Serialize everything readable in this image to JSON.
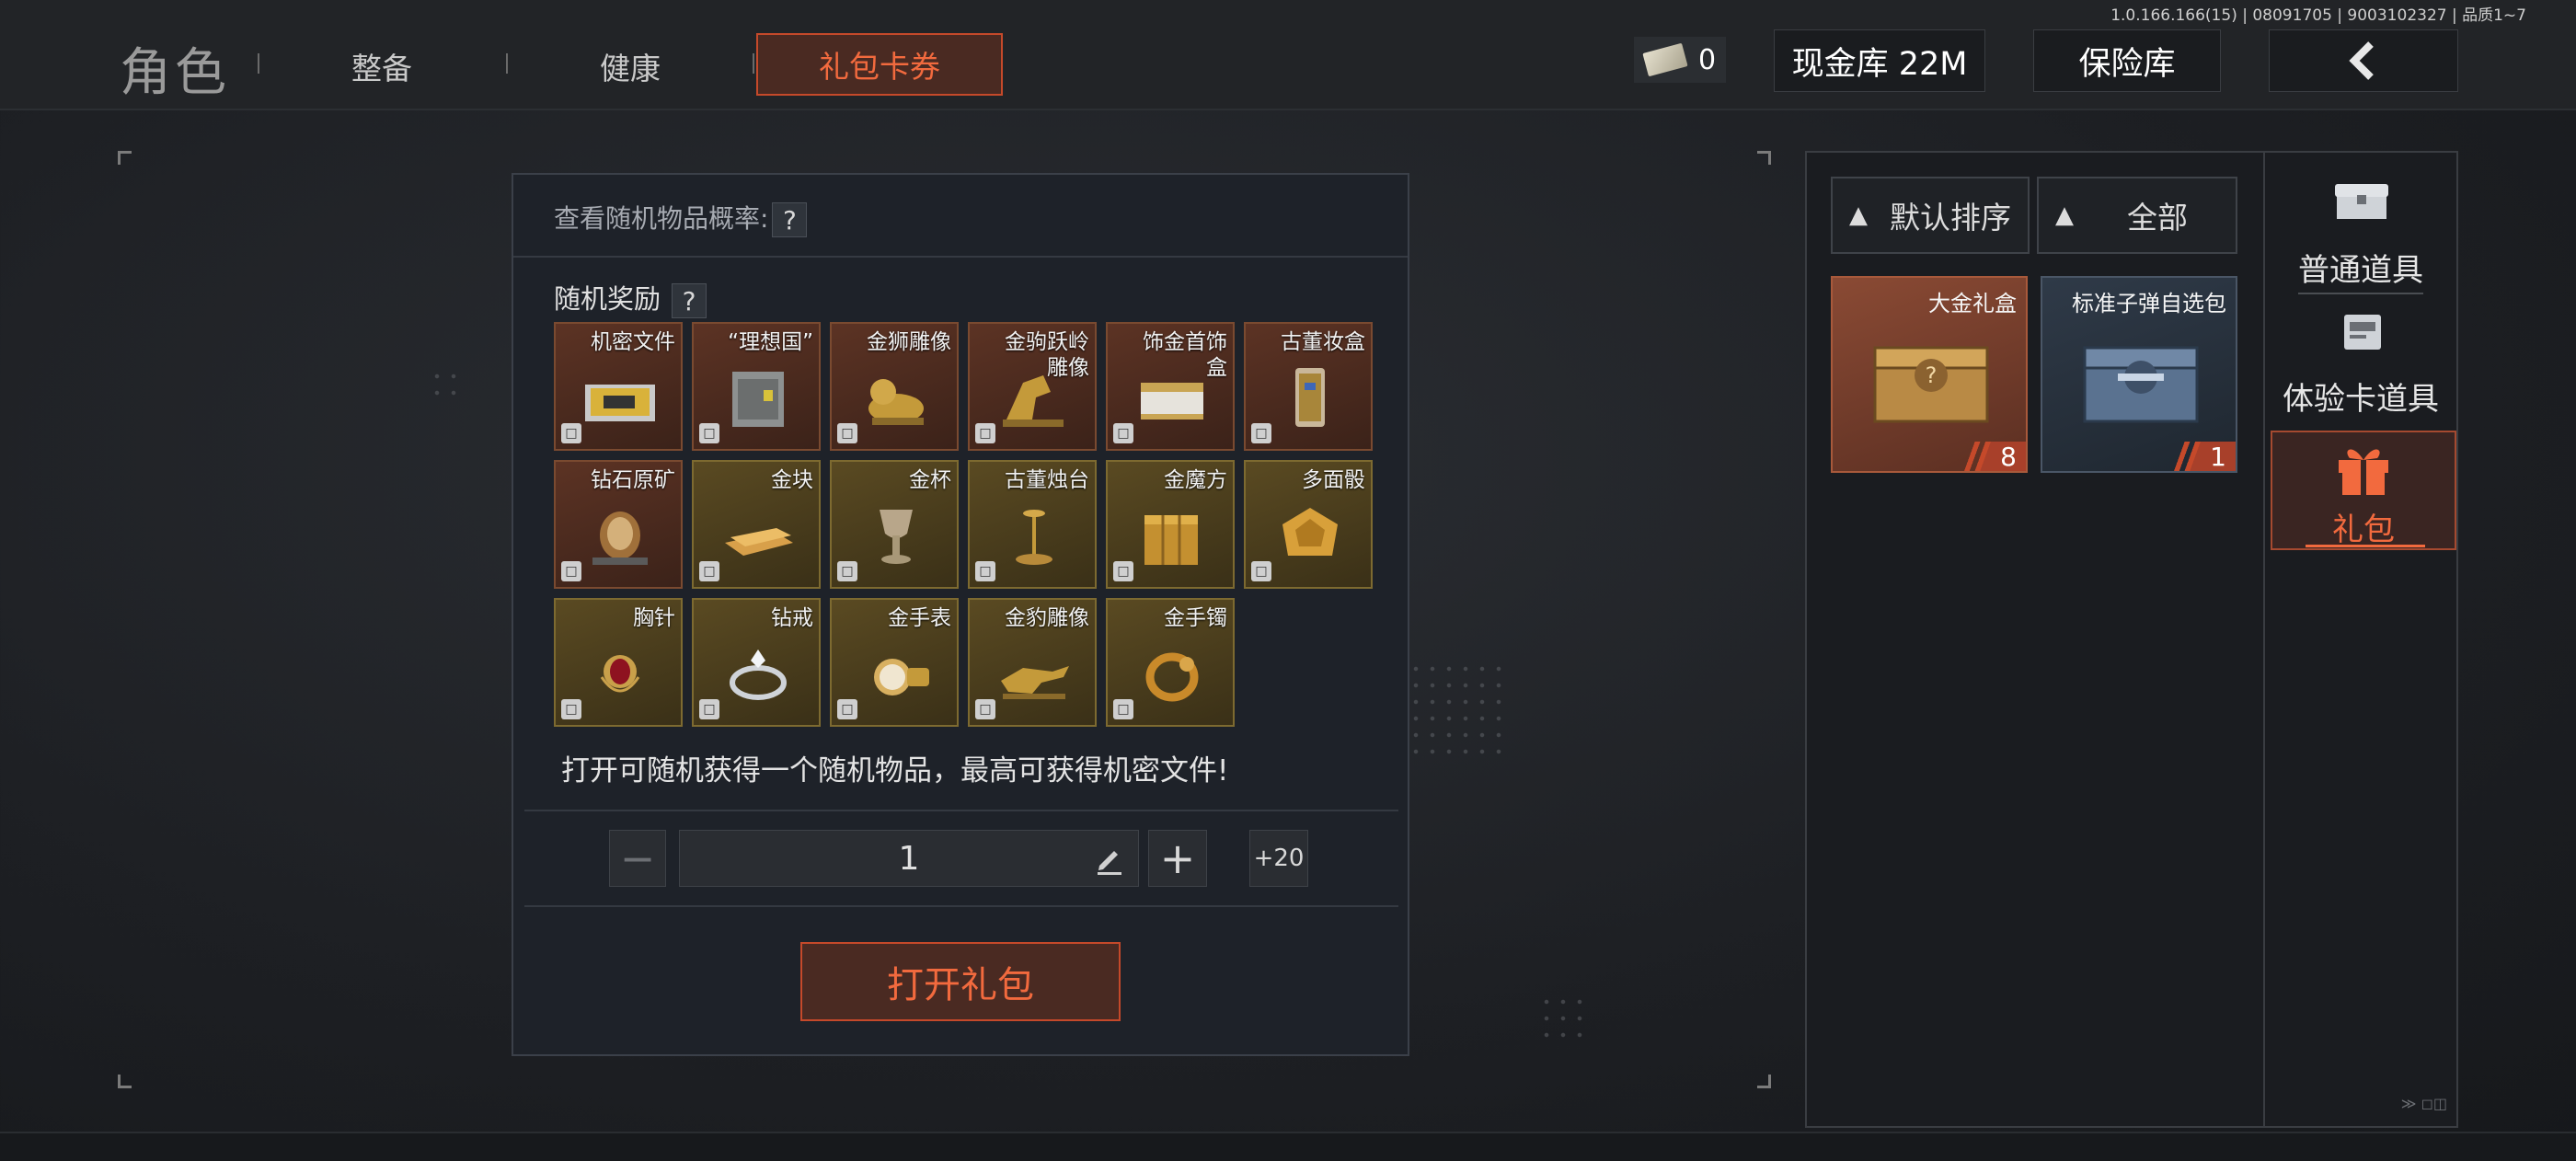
{
  "version": "1.0.166.166(15) | 08091705 | 9003102327 | 品质1~7",
  "top_nav": {
    "role": "角色",
    "tabs": [
      "整备",
      "健康"
    ],
    "active_tab": "礼包卡券",
    "cash_count": "0",
    "vault": "现金库 22M",
    "safe": "保险库"
  },
  "panel": {
    "prob_label": "查看随机物品概率:",
    "prob_help": "?",
    "reward_title": "随机奖励",
    "reward_help": "?",
    "items": [
      {
        "name": "机密文件",
        "style": "red"
      },
      {
        "name": "“理想国”",
        "style": "red"
      },
      {
        "name": "金狮雕像",
        "style": "red"
      },
      {
        "name": "金驹跃岭雕像",
        "style": "red"
      },
      {
        "name": "饰金首饰盒",
        "style": "red"
      },
      {
        "name": "古董妆盒",
        "style": "red"
      },
      {
        "name": "钻石原矿",
        "style": "red"
      },
      {
        "name": "金块",
        "style": "gold"
      },
      {
        "name": "金杯",
        "style": "gold"
      },
      {
        "name": "古董烛台",
        "style": "gold"
      },
      {
        "name": "金魔方",
        "style": "gold"
      },
      {
        "name": "多面骰",
        "style": "gold"
      },
      {
        "name": "胸针",
        "style": "gold"
      },
      {
        "name": "钻戒",
        "style": "gold"
      },
      {
        "name": "金手表",
        "style": "gold"
      },
      {
        "name": "金豹雕像",
        "style": "gold"
      },
      {
        "name": "金手镯",
        "style": "gold"
      }
    ],
    "description": "打开可随机获得一个随机物品，最高可获得机密文件!",
    "quantity": "1",
    "minus": "−",
    "plus": "+",
    "plus20": "+20",
    "open_button": "打开礼包"
  },
  "inventory": {
    "sort_label": "默认排序",
    "filter_label": "全部",
    "items": [
      {
        "name": "大金礼盒",
        "count": "8",
        "style": "orange"
      },
      {
        "name": "标准子弹自选包",
        "count": "1",
        "style": "blue"
      }
    ]
  },
  "categories": [
    {
      "label": "普通道具",
      "icon": "chest-icon",
      "active": false
    },
    {
      "label": "体验卡道具",
      "icon": "card-icon",
      "active": false
    },
    {
      "label": "礼包",
      "icon": "gift-icon",
      "active": true
    }
  ],
  "colors": {
    "accent": "#f26a3e",
    "accent_border": "#c5492a",
    "red_item_bg": "#5c3324",
    "gold_item_bg": "#5a4a22"
  },
  "watermark": "≫ ◻◫"
}
